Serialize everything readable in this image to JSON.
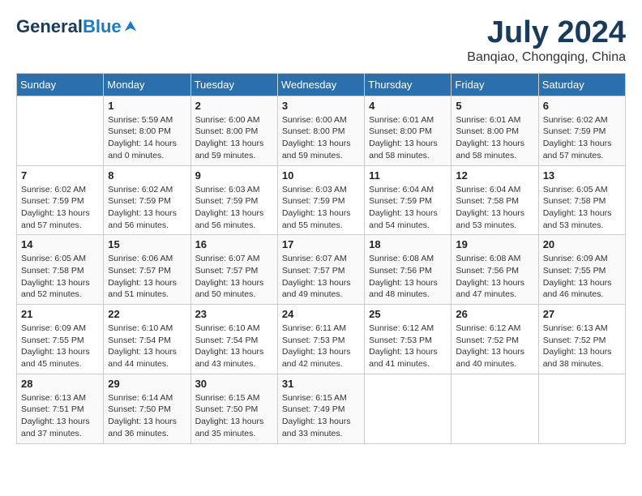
{
  "header": {
    "logo": {
      "general": "General",
      "blue": "Blue"
    },
    "title": "July 2024",
    "location": "Banqiao, Chongqing, China"
  },
  "calendar": {
    "weekdays": [
      "Sunday",
      "Monday",
      "Tuesday",
      "Wednesday",
      "Thursday",
      "Friday",
      "Saturday"
    ],
    "weeks": [
      [
        {
          "day": "",
          "info": ""
        },
        {
          "day": "1",
          "info": "Sunrise: 5:59 AM\nSunset: 8:00 PM\nDaylight: 14 hours\nand 0 minutes."
        },
        {
          "day": "2",
          "info": "Sunrise: 6:00 AM\nSunset: 8:00 PM\nDaylight: 13 hours\nand 59 minutes."
        },
        {
          "day": "3",
          "info": "Sunrise: 6:00 AM\nSunset: 8:00 PM\nDaylight: 13 hours\nand 59 minutes."
        },
        {
          "day": "4",
          "info": "Sunrise: 6:01 AM\nSunset: 8:00 PM\nDaylight: 13 hours\nand 58 minutes."
        },
        {
          "day": "5",
          "info": "Sunrise: 6:01 AM\nSunset: 8:00 PM\nDaylight: 13 hours\nand 58 minutes."
        },
        {
          "day": "6",
          "info": "Sunrise: 6:02 AM\nSunset: 7:59 PM\nDaylight: 13 hours\nand 57 minutes."
        }
      ],
      [
        {
          "day": "7",
          "info": "Sunrise: 6:02 AM\nSunset: 7:59 PM\nDaylight: 13 hours\nand 57 minutes."
        },
        {
          "day": "8",
          "info": "Sunrise: 6:02 AM\nSunset: 7:59 PM\nDaylight: 13 hours\nand 56 minutes."
        },
        {
          "day": "9",
          "info": "Sunrise: 6:03 AM\nSunset: 7:59 PM\nDaylight: 13 hours\nand 56 minutes."
        },
        {
          "day": "10",
          "info": "Sunrise: 6:03 AM\nSunset: 7:59 PM\nDaylight: 13 hours\nand 55 minutes."
        },
        {
          "day": "11",
          "info": "Sunrise: 6:04 AM\nSunset: 7:59 PM\nDaylight: 13 hours\nand 54 minutes."
        },
        {
          "day": "12",
          "info": "Sunrise: 6:04 AM\nSunset: 7:58 PM\nDaylight: 13 hours\nand 53 minutes."
        },
        {
          "day": "13",
          "info": "Sunrise: 6:05 AM\nSunset: 7:58 PM\nDaylight: 13 hours\nand 53 minutes."
        }
      ],
      [
        {
          "day": "14",
          "info": "Sunrise: 6:05 AM\nSunset: 7:58 PM\nDaylight: 13 hours\nand 52 minutes."
        },
        {
          "day": "15",
          "info": "Sunrise: 6:06 AM\nSunset: 7:57 PM\nDaylight: 13 hours\nand 51 minutes."
        },
        {
          "day": "16",
          "info": "Sunrise: 6:07 AM\nSunset: 7:57 PM\nDaylight: 13 hours\nand 50 minutes."
        },
        {
          "day": "17",
          "info": "Sunrise: 6:07 AM\nSunset: 7:57 PM\nDaylight: 13 hours\nand 49 minutes."
        },
        {
          "day": "18",
          "info": "Sunrise: 6:08 AM\nSunset: 7:56 PM\nDaylight: 13 hours\nand 48 minutes."
        },
        {
          "day": "19",
          "info": "Sunrise: 6:08 AM\nSunset: 7:56 PM\nDaylight: 13 hours\nand 47 minutes."
        },
        {
          "day": "20",
          "info": "Sunrise: 6:09 AM\nSunset: 7:55 PM\nDaylight: 13 hours\nand 46 minutes."
        }
      ],
      [
        {
          "day": "21",
          "info": "Sunrise: 6:09 AM\nSunset: 7:55 PM\nDaylight: 13 hours\nand 45 minutes."
        },
        {
          "day": "22",
          "info": "Sunrise: 6:10 AM\nSunset: 7:54 PM\nDaylight: 13 hours\nand 44 minutes."
        },
        {
          "day": "23",
          "info": "Sunrise: 6:10 AM\nSunset: 7:54 PM\nDaylight: 13 hours\nand 43 minutes."
        },
        {
          "day": "24",
          "info": "Sunrise: 6:11 AM\nSunset: 7:53 PM\nDaylight: 13 hours\nand 42 minutes."
        },
        {
          "day": "25",
          "info": "Sunrise: 6:12 AM\nSunset: 7:53 PM\nDaylight: 13 hours\nand 41 minutes."
        },
        {
          "day": "26",
          "info": "Sunrise: 6:12 AM\nSunset: 7:52 PM\nDaylight: 13 hours\nand 40 minutes."
        },
        {
          "day": "27",
          "info": "Sunrise: 6:13 AM\nSunset: 7:52 PM\nDaylight: 13 hours\nand 38 minutes."
        }
      ],
      [
        {
          "day": "28",
          "info": "Sunrise: 6:13 AM\nSunset: 7:51 PM\nDaylight: 13 hours\nand 37 minutes."
        },
        {
          "day": "29",
          "info": "Sunrise: 6:14 AM\nSunset: 7:50 PM\nDaylight: 13 hours\nand 36 minutes."
        },
        {
          "day": "30",
          "info": "Sunrise: 6:15 AM\nSunset: 7:50 PM\nDaylight: 13 hours\nand 35 minutes."
        },
        {
          "day": "31",
          "info": "Sunrise: 6:15 AM\nSunset: 7:49 PM\nDaylight: 13 hours\nand 33 minutes."
        },
        {
          "day": "",
          "info": ""
        },
        {
          "day": "",
          "info": ""
        },
        {
          "day": "",
          "info": ""
        }
      ]
    ]
  }
}
